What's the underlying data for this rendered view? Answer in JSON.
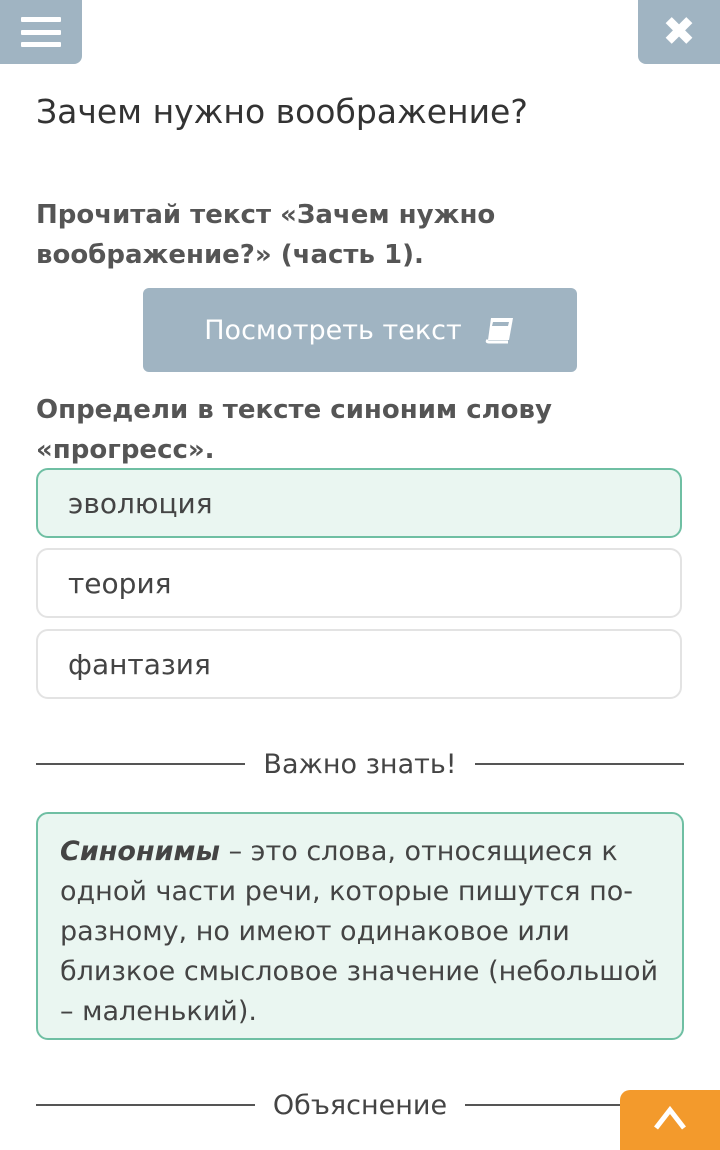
{
  "header": {
    "menu_icon": "hamburger-menu-icon",
    "close_icon": "close-x-icon",
    "close_glyph": "✖"
  },
  "page": {
    "title": "Зачем нужно воображение?"
  },
  "task": {
    "instruction": "Прочитай текст «Зачем нужно воображение?» (часть 1).",
    "view_button_label": "Посмотреть текст",
    "view_button_icon": "book-icon",
    "question": "Определи в тексте синоним слову «прогресс»."
  },
  "options": [
    {
      "label": "эволюция",
      "selected": true
    },
    {
      "label": "теория",
      "selected": false
    },
    {
      "label": "фантазия",
      "selected": false
    }
  ],
  "important": {
    "heading": "Важно знать!",
    "term": "Синонимы",
    "definition": " – это слова, относящиеся к одной части речи, которые пишутся по-разному, но имеют одинаковое или близкое смысловое значение (небольшой – маленький)."
  },
  "explanation": {
    "heading": "Объяснение"
  },
  "colors": {
    "header_button": "#a0b4c2",
    "selected_bg": "#eaf6f1",
    "selected_border": "#6fbfa3",
    "accent_orange": "#f39a2c"
  },
  "up_button_icon": "chevron-up-icon"
}
